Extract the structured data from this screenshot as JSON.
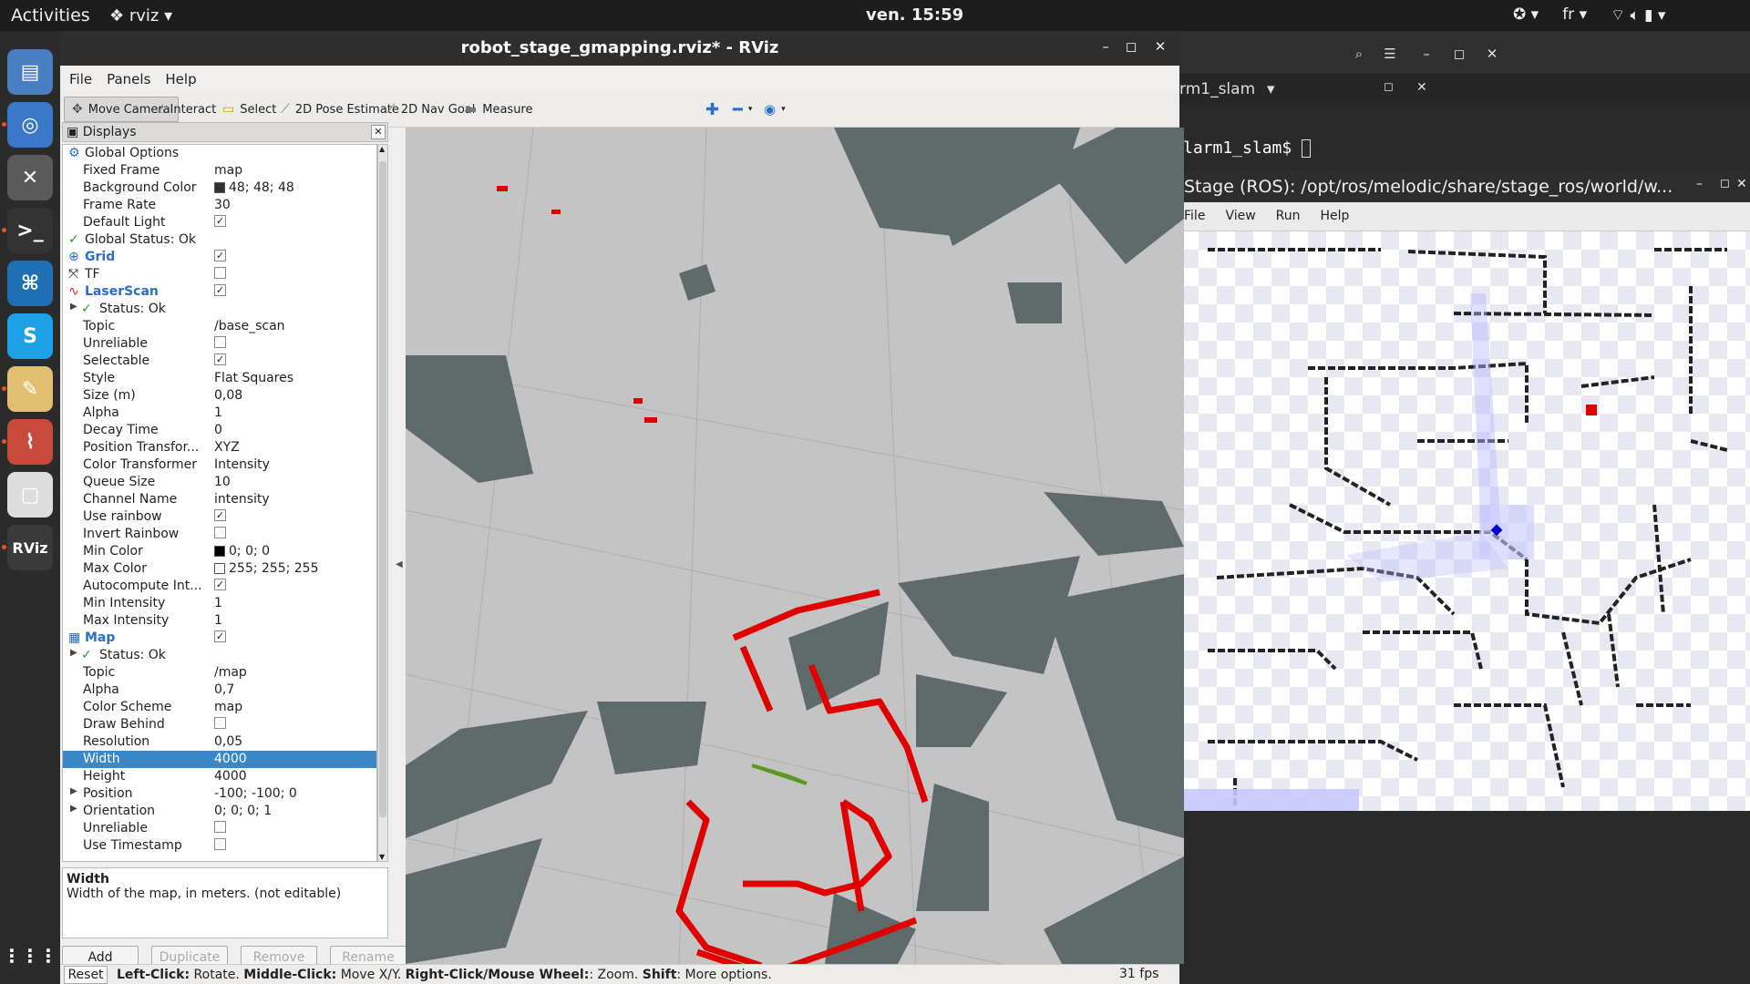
{
  "topbar": {
    "activities": "Activities",
    "app_menu": "rviz",
    "clock": "ven. 15:59",
    "lang": "fr"
  },
  "dock": {
    "items": [
      {
        "name": "files",
        "color": "#4a7ec2",
        "glyph": "▤"
      },
      {
        "name": "chromium",
        "color": "#3a78c9",
        "glyph": "◎"
      },
      {
        "name": "tools",
        "color": "#5a5a5a",
        "glyph": "✕"
      },
      {
        "name": "terminal",
        "color": "#333333",
        "glyph": ">_"
      },
      {
        "name": "vscode",
        "color": "#1f6fb5",
        "glyph": "⌘"
      },
      {
        "name": "skype",
        "color": "#1ea0e6",
        "glyph": "S"
      },
      {
        "name": "text-editor",
        "color": "#e0c070",
        "glyph": "✎"
      },
      {
        "name": "pdf-viewer",
        "color": "#c84a3a",
        "glyph": "⌇"
      },
      {
        "name": "blank-app",
        "color": "#dddddd",
        "glyph": "▢"
      },
      {
        "name": "rviz",
        "color": "#3a3a3a",
        "glyph": "RViz"
      }
    ],
    "apps_grid": "⋮⋮⋮"
  },
  "rviz": {
    "title": "robot_stage_gmapping.rviz* - RViz",
    "menu": [
      "File",
      "Panels",
      "Help"
    ],
    "tools": [
      {
        "label": "Move Camera",
        "icon": "✥",
        "active": true
      },
      {
        "label": "Interact",
        "icon": "☝"
      },
      {
        "label": "Select",
        "icon": "▭"
      },
      {
        "label": "2D Pose Estimate",
        "icon": "⟋"
      },
      {
        "label": "2D Nav Goal",
        "icon": "⟋"
      },
      {
        "label": "Measure",
        "icon": "▬"
      }
    ],
    "displays_title": "Displays",
    "tree": [
      {
        "indent": 0,
        "icon": "⚙",
        "name": "Global Options",
        "value": "",
        "type": "header"
      },
      {
        "indent": 1,
        "name": "Fixed Frame",
        "value": "map"
      },
      {
        "indent": 1,
        "name": "Background Color",
        "value": "48; 48; 48",
        "swatch": "#303030"
      },
      {
        "indent": 1,
        "name": "Frame Rate",
        "value": "30"
      },
      {
        "indent": 1,
        "name": "Default Light",
        "check": true
      },
      {
        "indent": 0,
        "icon": "✓",
        "name": "Global Status: Ok",
        "value": "",
        "type": "status"
      },
      {
        "indent": 0,
        "icon": "⊕",
        "name": "Grid",
        "check": true,
        "type": "disp"
      },
      {
        "indent": 0,
        "icon": "⤧",
        "name": "TF",
        "check": false,
        "type": "plain"
      },
      {
        "indent": 0,
        "icon": "∿",
        "name": "LaserScan",
        "check": true,
        "type": "disp"
      },
      {
        "indent": 1,
        "icon": "✓",
        "name": "Status: Ok",
        "value": "",
        "type": "status",
        "arrow": true
      },
      {
        "indent": 1,
        "name": "Topic",
        "value": "/base_scan"
      },
      {
        "indent": 1,
        "name": "Unreliable",
        "check": false
      },
      {
        "indent": 1,
        "name": "Selectable",
        "check": true
      },
      {
        "indent": 1,
        "name": "Style",
        "value": "Flat Squares"
      },
      {
        "indent": 1,
        "name": "Size (m)",
        "value": "0,08"
      },
      {
        "indent": 1,
        "name": "Alpha",
        "value": "1"
      },
      {
        "indent": 1,
        "name": "Decay Time",
        "value": "0"
      },
      {
        "indent": 1,
        "name": "Position Transfor...",
        "value": "XYZ"
      },
      {
        "indent": 1,
        "name": "Color Transformer",
        "value": "Intensity"
      },
      {
        "indent": 1,
        "name": "Queue Size",
        "value": "10"
      },
      {
        "indent": 1,
        "name": "Channel Name",
        "value": "intensity"
      },
      {
        "indent": 1,
        "name": "Use rainbow",
        "check": true
      },
      {
        "indent": 1,
        "name": "Invert Rainbow",
        "check": false
      },
      {
        "indent": 1,
        "name": "Min Color",
        "value": "0; 0; 0",
        "swatch": "#000000"
      },
      {
        "indent": 1,
        "name": "Max Color",
        "value": "255; 255; 255",
        "swatch": "#ffffff"
      },
      {
        "indent": 1,
        "name": "Autocompute Int...",
        "check": true
      },
      {
        "indent": 1,
        "name": "Min Intensity",
        "value": "1"
      },
      {
        "indent": 1,
        "name": "Max Intensity",
        "value": "1"
      },
      {
        "indent": 0,
        "icon": "▦",
        "name": "Map",
        "check": true,
        "type": "disp"
      },
      {
        "indent": 1,
        "icon": "✓",
        "name": "Status: Ok",
        "value": "",
        "type": "status",
        "arrow": true
      },
      {
        "indent": 1,
        "name": "Topic",
        "value": "/map"
      },
      {
        "indent": 1,
        "name": "Alpha",
        "value": "0,7"
      },
      {
        "indent": 1,
        "name": "Color Scheme",
        "value": "map"
      },
      {
        "indent": 1,
        "name": "Draw Behind",
        "check": false
      },
      {
        "indent": 1,
        "name": "Resolution",
        "value": "0,05"
      },
      {
        "indent": 1,
        "name": "Width",
        "value": "4000",
        "selected": true
      },
      {
        "indent": 1,
        "name": "Height",
        "value": "4000"
      },
      {
        "indent": 1,
        "name": "Position",
        "value": "-100; -100; 0",
        "arrow": true
      },
      {
        "indent": 1,
        "name": "Orientation",
        "value": "0; 0; 0; 1",
        "arrow": true
      },
      {
        "indent": 1,
        "name": "Unreliable",
        "check": false
      },
      {
        "indent": 1,
        "name": "Use Timestamp",
        "check": false
      }
    ],
    "description": {
      "title": "Width",
      "text": "Width of the map, in meters. (not editable)"
    },
    "buttons": {
      "add": "Add",
      "duplicate": "Duplicate",
      "remove": "Remove",
      "rename": "Rename"
    },
    "status": {
      "reset": "Reset",
      "hint_parts": [
        {
          "b": "Left-Click:"
        },
        {
          "t": " Rotate. "
        },
        {
          "b": "Middle-Click:"
        },
        {
          "t": " Move X/Y. "
        },
        {
          "b": "Right-Click/Mouse Wheel:"
        },
        {
          "t": ": Zoom. "
        },
        {
          "b": "Shift"
        },
        {
          "t": ": More options."
        }
      ],
      "fps": "31 fps"
    }
  },
  "terminal": {
    "tab_title": "rm1_slam",
    "prompt": "larm1_slam$ "
  },
  "stage": {
    "title": "Stage (ROS): /opt/ros/melodic/share/stage_ros/world/w...",
    "menu": [
      "File",
      "View",
      "Run",
      "Help"
    ]
  }
}
